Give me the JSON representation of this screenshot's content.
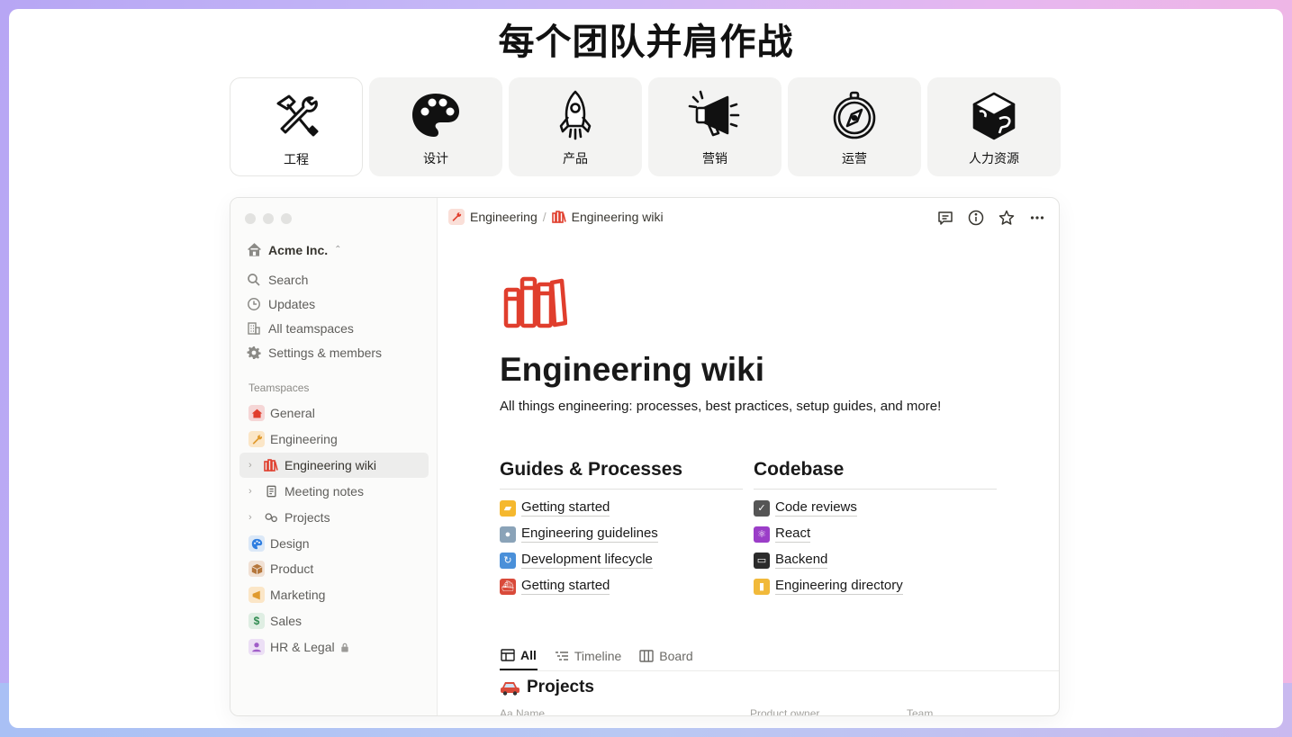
{
  "headline": "每个团队并肩作战",
  "teams": [
    {
      "label": "工程",
      "icon": "hammer-wrench-icon",
      "active": true
    },
    {
      "label": "设计",
      "icon": "palette-icon",
      "active": false
    },
    {
      "label": "产品",
      "icon": "rocket-icon",
      "active": false
    },
    {
      "label": "营销",
      "icon": "megaphone-icon",
      "active": false
    },
    {
      "label": "运营",
      "icon": "compass-icon",
      "active": false
    },
    {
      "label": "人力资源",
      "icon": "puzzle-cube-icon",
      "active": false
    }
  ],
  "sidebar": {
    "workspace": "Acme Inc.",
    "nav": [
      {
        "label": "Search",
        "icon": "search-icon"
      },
      {
        "label": "Updates",
        "icon": "clock-icon"
      },
      {
        "label": "All teamspaces",
        "icon": "building-icon"
      },
      {
        "label": "Settings & members",
        "icon": "gear-icon"
      }
    ],
    "teamspaces_label": "Teamspaces",
    "teamspaces": [
      {
        "label": "General",
        "icon": "house-icon",
        "color": "#f5d6d6"
      },
      {
        "label": "Engineering",
        "icon": "wrench-icon",
        "color": "#fbe6c7"
      },
      {
        "label": "Engineering wiki",
        "icon": "books-icon"
      },
      {
        "label": "Meeting notes",
        "icon": "notepad-icon"
      },
      {
        "label": "Projects",
        "icon": "gears-icon"
      },
      {
        "label": "Design",
        "icon": "palette-icon",
        "color": "#dbe8f7"
      },
      {
        "label": "Product",
        "icon": "box-icon",
        "color": "#f1e1d4"
      },
      {
        "label": "Marketing",
        "icon": "megaphone-icon",
        "color": "#fbe6c7"
      },
      {
        "label": "Sales",
        "icon": "dollar-icon",
        "color": "#dfeee3"
      },
      {
        "label": "HR & Legal",
        "icon": "person-icon",
        "color": "#ecdff5"
      }
    ]
  },
  "breadcrumb": [
    "Engineering",
    "Engineering wiki"
  ],
  "page": {
    "title": "Engineering wiki",
    "description": "All things engineering: processes, best practices, setup guides, and more!",
    "guides": {
      "heading": "Guides & Processes",
      "items": [
        "Getting started",
        "Engineering guidelines",
        "Development lifecycle",
        "Getting started"
      ]
    },
    "codebase": {
      "heading": "Codebase",
      "items": [
        "Code reviews",
        "React",
        "Backend",
        "Engineering directory"
      ]
    },
    "views": [
      "All",
      "Timeline",
      "Board"
    ],
    "database": {
      "title": "Projects",
      "columns": [
        "Aa Name",
        "Product owner",
        "Team"
      ]
    }
  },
  "colors": {
    "accent_red": "#e03e2d"
  }
}
